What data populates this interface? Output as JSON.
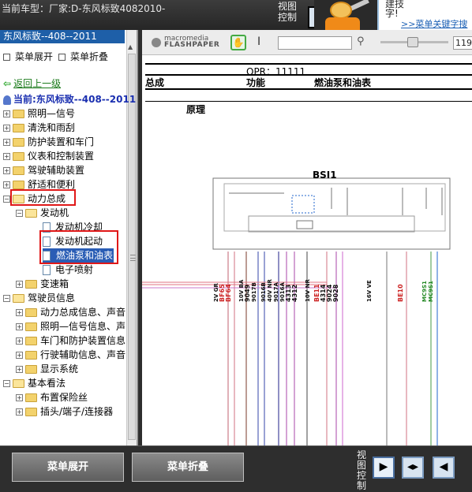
{
  "topbar": {
    "title": "当前车型：厂家:D-东风标致4082010-",
    "view_control": "视图控制",
    "ad_line1": "建技",
    "ad_line2": "字!",
    "ad_link": ">>菜单关键字搜"
  },
  "sidebar": {
    "header": "东风标致--408--2011",
    "expand_label": "菜单展开",
    "collapse_label": "菜单折叠",
    "back_label": "返回上一级",
    "current_label": "当前:东风标致--408--2011",
    "tree": [
      {
        "label": "照明—信号"
      },
      {
        "label": "清洗和雨刮"
      },
      {
        "label": "防护装置和车门"
      },
      {
        "label": "仪表和控制装置"
      },
      {
        "label": "驾驶辅助装置"
      },
      {
        "label": "舒适和便利"
      },
      {
        "label": "动力总成"
      },
      {
        "label": "发动机"
      },
      {
        "label": "发动机冷却"
      },
      {
        "label": "发动机起动"
      },
      {
        "label": "燃油泵和油表"
      },
      {
        "label": "电子喷射"
      },
      {
        "label": "变速箱"
      },
      {
        "label": "驾驶员信息"
      },
      {
        "label": "动力总成信息、声音"
      },
      {
        "label": "照明—信号信息、声"
      },
      {
        "label": "车门和防护装置信息"
      },
      {
        "label": "行驶辅助信息、声音"
      },
      {
        "label": "显示系统"
      },
      {
        "label": "基本看法"
      },
      {
        "label": "布置保险丝"
      },
      {
        "label": "插头/端子/连接器"
      }
    ]
  },
  "viewer": {
    "logo_top": "macromedia",
    "logo_bottom": "FLASHPAPER",
    "zoom": "119",
    "opr": "OPR：11111",
    "col1": "总成",
    "col2": "功能",
    "col3": "燃油泵和油表",
    "principle": "原理",
    "module": "BSI1",
    "wire_labels": [
      "2V GR",
      "BF65",
      "BF64",
      "10V BA",
      "9049",
      "9017B",
      "9016B",
      "40V NR",
      "9017A",
      "9016A",
      "4313",
      "4312",
      "10V NR",
      "BE11",
      "4314",
      "9024",
      "9028",
      "16V VE",
      "BE10",
      "MC9S1",
      "MC9S1"
    ]
  },
  "bottom": {
    "expand": "菜单展开",
    "collapse": "菜单折叠",
    "view_control": "视图控制"
  }
}
